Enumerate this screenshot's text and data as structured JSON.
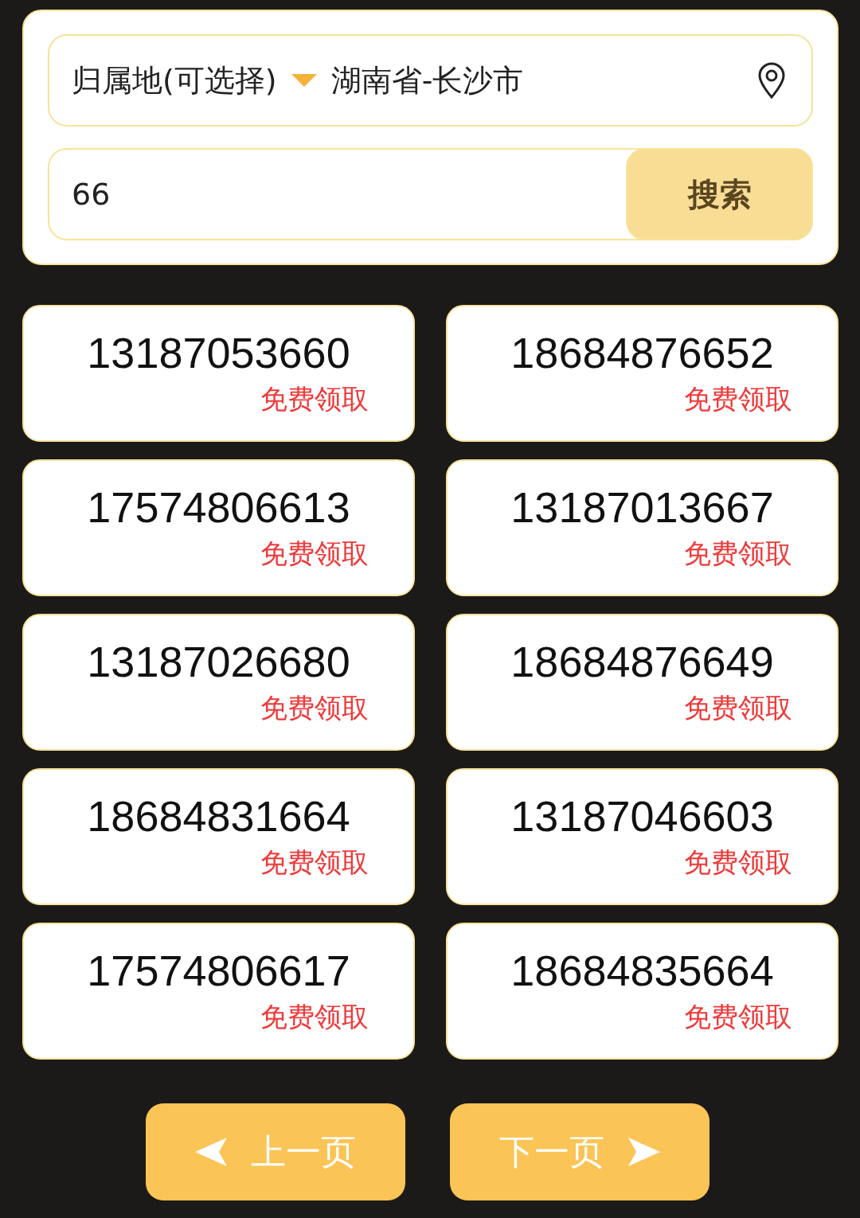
{
  "location": {
    "label": "归属地(可选择)",
    "value": "湖南省-长沙市"
  },
  "search": {
    "value": "66",
    "button": "搜索"
  },
  "numbers": [
    {
      "number": "13187053660",
      "action": "免费领取"
    },
    {
      "number": "18684876652",
      "action": "免费领取"
    },
    {
      "number": "17574806613",
      "action": "免费领取"
    },
    {
      "number": "13187013667",
      "action": "免费领取"
    },
    {
      "number": "13187026680",
      "action": "免费领取"
    },
    {
      "number": "18684876649",
      "action": "免费领取"
    },
    {
      "number": "18684831664",
      "action": "免费领取"
    },
    {
      "number": "13187046603",
      "action": "免费领取"
    },
    {
      "number": "17574806617",
      "action": "免费领取"
    },
    {
      "number": "18684835664",
      "action": "免费领取"
    }
  ],
  "pagination": {
    "prev": "上一页",
    "next": "下一页"
  }
}
